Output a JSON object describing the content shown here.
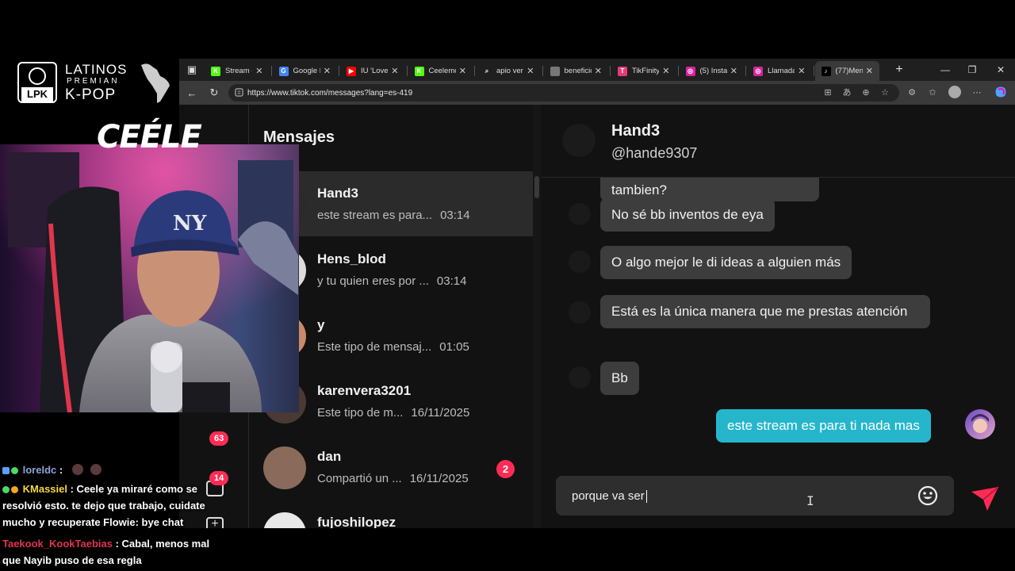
{
  "browser": {
    "tabs": [
      {
        "title": "Stream -",
        "favicon": "kick-icon",
        "color": "#53fc18",
        "glyph": "K"
      },
      {
        "title": "Google M",
        "favicon": "google-icon",
        "color": "#4285f4",
        "glyph": "G"
      },
      {
        "title": "IU 'Love w",
        "favicon": "youtube-icon",
        "color": "#ff0000",
        "glyph": "▶"
      },
      {
        "title": "Ceelemor",
        "favicon": "kick-icon",
        "color": "#53fc18",
        "glyph": "K"
      },
      {
        "title": "apio verd",
        "favicon": "search-icon",
        "color": "#1f1f1f",
        "glyph": "⌕"
      },
      {
        "title": "beneficio",
        "favicon": "doc-icon",
        "color": "#777777",
        "glyph": ""
      },
      {
        "title": "TikFinity",
        "favicon": "tikfinity-icon",
        "color": "#e63b7a",
        "glyph": "T"
      },
      {
        "title": "(5) Instag",
        "favicon": "instagram-icon",
        "color": "#d6249f",
        "glyph": "◎"
      },
      {
        "title": "Llamada",
        "favicon": "instagram-icon",
        "color": "#d6249f",
        "glyph": "◎"
      },
      {
        "title": "(77)Mens",
        "favicon": "tiktok-icon",
        "color": "#000000",
        "glyph": "♪"
      }
    ],
    "new_tab": "+",
    "window_controls": {
      "minimize": "—",
      "restore": "❐",
      "close": "✕"
    },
    "url": "https://www.tiktok.com/messages?lang=es-419"
  },
  "sidebar": {
    "badge_top": "63",
    "badge_messages": "14"
  },
  "messages_list": {
    "title": "Mensajes",
    "conversations": [
      {
        "name": "Hand3",
        "preview": "este stream es para...",
        "time": "03:14",
        "selected": true
      },
      {
        "name": "Hens_blod",
        "preview": "y tu quien eres por ...",
        "time": "03:14"
      },
      {
        "name": "y",
        "preview": "Este tipo de mensaj...",
        "time": "01:05"
      },
      {
        "name": "karenvera3201",
        "preview": "Este tipo de m...",
        "time": "16/11/2025"
      },
      {
        "name": "dan",
        "preview": "Compartió un ...",
        "time": "16/11/2025",
        "unread": "2"
      },
      {
        "name": "fujoshilopez",
        "preview": "",
        "time": ""
      }
    ]
  },
  "chat": {
    "name": "Hand3",
    "username": "@hande9307",
    "messages": [
      {
        "text": "tambien?",
        "from": "them"
      },
      {
        "text": "No sé bb inventos de eya",
        "from": "them"
      },
      {
        "text": "O algo mejor le di ideas a alguien más",
        "from": "them"
      },
      {
        "text": "Está es la única manera que me prestas atención",
        "from": "them"
      },
      {
        "text": "Bb",
        "from": "them"
      },
      {
        "text": "este stream es para ti nada mas",
        "from": "me"
      }
    ],
    "composer_text": "porque va ser"
  },
  "overlay": {
    "logo": {
      "line1": "LATINOS",
      "line2": "PREMIAN",
      "line3": "K-POP",
      "box_text": "LPK"
    },
    "channel_name": "CEÉLE",
    "stream_chat": [
      {
        "user": "loreldc",
        "text": " :"
      },
      {
        "user": "KMassiel",
        "text": " : Ceele ya miraré como se resolvió esto. te dejo que trabajo, cuidate mucho y recuperate Flowie: bye chat"
      },
      {
        "user": "Taekook_KookTaebias",
        "text": " : Cabal, menos mal que Nayib puso de esa regla"
      }
    ]
  },
  "colors": {
    "tiktok_red": "#fe2c55",
    "my_bubble": "#25b6cc",
    "their_bubble": "#3d3d3d"
  }
}
